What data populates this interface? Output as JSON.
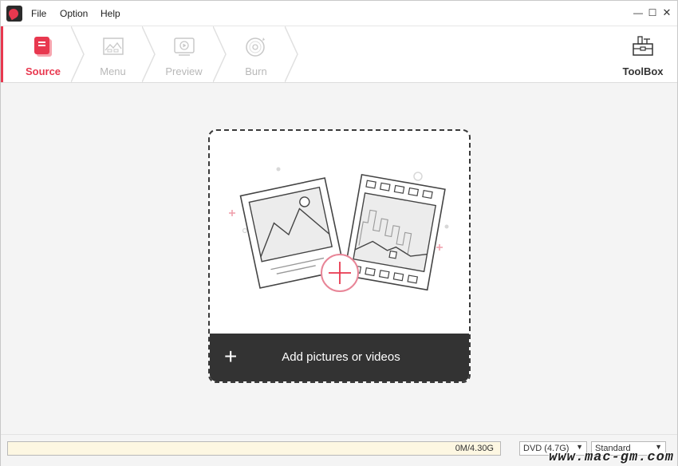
{
  "menu": {
    "file": "File",
    "option": "Option",
    "help": "Help"
  },
  "window_controls": {
    "minimize": "—",
    "maximize": "☐",
    "close": "✕"
  },
  "steps": [
    {
      "label": "Source",
      "active": true
    },
    {
      "label": "Menu",
      "active": false
    },
    {
      "label": "Preview",
      "active": false
    },
    {
      "label": "Burn",
      "active": false
    }
  ],
  "toolbox": {
    "label": "ToolBox"
  },
  "dropzone": {
    "add_label": "Add pictures or videos",
    "plus_glyph": "+"
  },
  "status": {
    "capacity_text": "0M/4.30G",
    "capacity_fraction": 0,
    "disc_type": "DVD (4.7G)",
    "quality": "Standard"
  },
  "watermark": "www.mac-gm.com",
  "colors": {
    "accent": "#e8384f",
    "dark_bar": "#333333",
    "inactive": "#b8b8b8"
  }
}
